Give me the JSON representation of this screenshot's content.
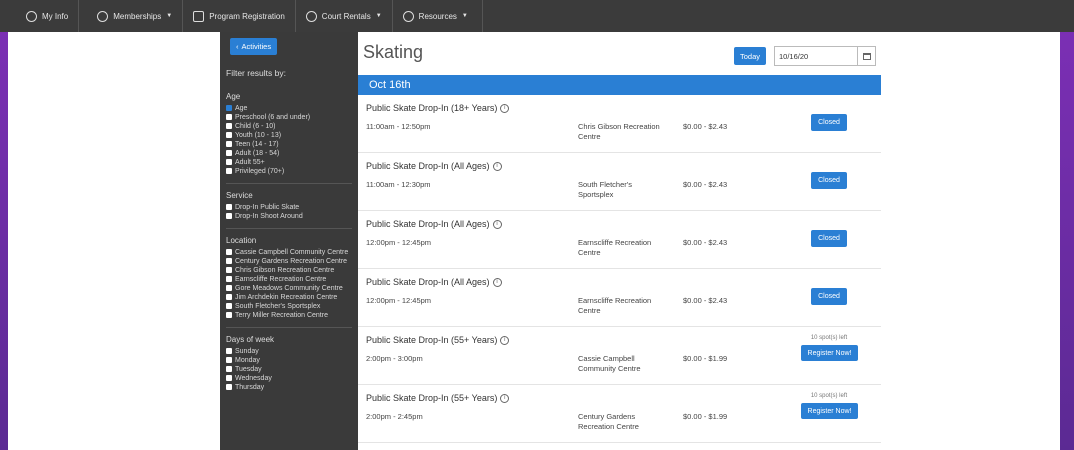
{
  "nav": {
    "items": [
      {
        "label": "My Info",
        "icon": "user-circle-icon",
        "caret": false
      },
      {
        "label": "Memberships",
        "icon": "globe-icon",
        "caret": true
      },
      {
        "label": "Program Registration",
        "icon": "clipboard-icon",
        "caret": false
      },
      {
        "label": "Court Rentals",
        "icon": "globe-icon",
        "caret": true
      },
      {
        "label": "Resources",
        "icon": "globe-icon",
        "caret": true
      }
    ]
  },
  "sidebar": {
    "back_label": "Activities",
    "filter_title": "Filter results by:",
    "groups": [
      {
        "title": "Age",
        "options": [
          {
            "label": "Age",
            "checked": true
          },
          {
            "label": "Preschool (6 and under)",
            "checked": false
          },
          {
            "label": "Child (6 - 10)",
            "checked": false
          },
          {
            "label": "Youth (10 - 13)",
            "checked": false
          },
          {
            "label": "Teen (14 - 17)",
            "checked": false
          },
          {
            "label": "Adult (18 - 54)",
            "checked": false
          },
          {
            "label": "Adult 55+",
            "checked": false
          },
          {
            "label": "Privileged (70+)",
            "checked": false
          }
        ]
      },
      {
        "title": "Service",
        "options": [
          {
            "label": "Drop-In Public Skate",
            "checked": false
          },
          {
            "label": "Drop-In Shoot Around",
            "checked": false
          }
        ]
      },
      {
        "title": "Location",
        "options": [
          {
            "label": "Cassie Campbell Community Centre",
            "checked": false
          },
          {
            "label": "Century Gardens Recreation Centre",
            "checked": false
          },
          {
            "label": "Chris Gibson Recreation Centre",
            "checked": false
          },
          {
            "label": "Earnscliffe Recreation Centre",
            "checked": false
          },
          {
            "label": "Gore Meadows Community Centre",
            "checked": false
          },
          {
            "label": "Jim Archdekin Recreation Centre",
            "checked": false
          },
          {
            "label": "South Fletcher's Sportsplex",
            "checked": false
          },
          {
            "label": "Terry Miller Recreation Centre",
            "checked": false
          }
        ]
      },
      {
        "title": "Days of week",
        "options": [
          {
            "label": "Sunday",
            "checked": false
          },
          {
            "label": "Monday",
            "checked": false
          },
          {
            "label": "Tuesday",
            "checked": false
          },
          {
            "label": "Wednesday",
            "checked": false
          },
          {
            "label": "Thursday",
            "checked": false
          }
        ]
      }
    ]
  },
  "content": {
    "title": "Skating",
    "today_label": "Today",
    "date_value": "10/16/20",
    "day_header": "Oct 16th",
    "rows": [
      {
        "title": "Public Skate Drop-In (18+ Years)",
        "time": "11:00am - 12:50pm",
        "location": "Chris Gibson Recreation Centre",
        "price": "$0.00 - $2.43",
        "status": "Closed",
        "spots": ""
      },
      {
        "title": "Public Skate Drop-In (All Ages)",
        "time": "11:00am - 12:30pm",
        "location": "South Fletcher's Sportsplex",
        "price": "$0.00 - $2.43",
        "status": "Closed",
        "spots": ""
      },
      {
        "title": "Public Skate Drop-In (All Ages)",
        "time": "12:00pm - 12:45pm",
        "location": "Earnscliffe Recreation Centre",
        "price": "$0.00 - $2.43",
        "status": "Closed",
        "spots": ""
      },
      {
        "title": "Public Skate Drop-In (All Ages)",
        "time": "12:00pm - 12:45pm",
        "location": "Earnscliffe Recreation Centre",
        "price": "$0.00 - $2.43",
        "status": "Closed",
        "spots": ""
      },
      {
        "title": "Public Skate Drop-In (55+ Years)",
        "time": "2:00pm - 3:00pm",
        "location": "Cassie Campbell Community Centre",
        "price": "$0.00 - $1.99",
        "status": "Register Now!",
        "spots": "10 spot(s) left"
      },
      {
        "title": "Public Skate Drop-In (55+ Years)",
        "time": "2:00pm - 2:45pm",
        "location": "Century Gardens Recreation Centre",
        "price": "$0.00 - $1.99",
        "status": "Register Now!",
        "spots": "10 spot(s) left"
      }
    ]
  },
  "colors": {
    "accent": "#2a7fd4",
    "sidebar": "#3a3a3a",
    "topbar": "#3b3b3b",
    "background": "#6a2a9c"
  }
}
